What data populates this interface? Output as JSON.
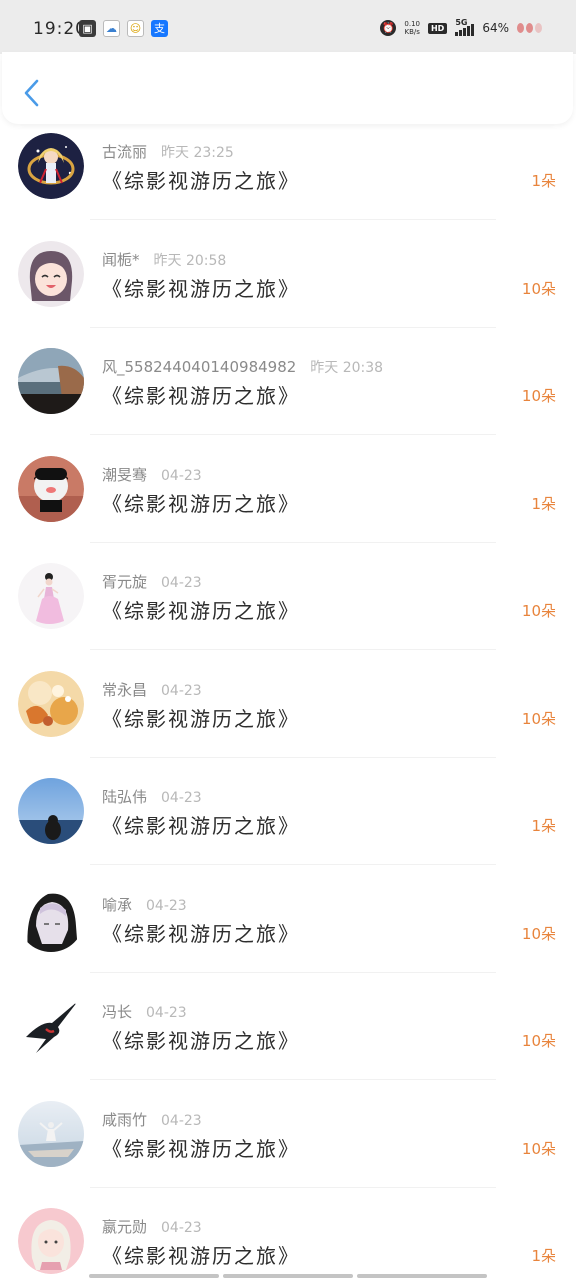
{
  "status_bar": {
    "time": "19:20",
    "net_speed_value": "0.10",
    "net_speed_unit": "KB/s",
    "hd": "HD",
    "network": "5G",
    "battery": "64%"
  },
  "header": {
    "back_icon": "chevron-left-icon"
  },
  "colors": {
    "accent": "#e8843c",
    "back": "#4a9be8"
  },
  "gifts": [
    {
      "user": "古流丽",
      "time": "昨天 23:25",
      "work": "《综影视游历之旅》",
      "count": "1朵"
    },
    {
      "user": "闻栀*",
      "time": "昨天 20:58",
      "work": "《综影视游历之旅》",
      "count": "10朵"
    },
    {
      "user": "风_558244040140984982",
      "time": "昨天 20:38",
      "work": "《综影视游历之旅》",
      "count": "10朵"
    },
    {
      "user": "潮旻骞",
      "time": "04-23",
      "work": "《综影视游历之旅》",
      "count": "1朵"
    },
    {
      "user": "胥元旋",
      "time": "04-23",
      "work": "《综影视游历之旅》",
      "count": "10朵"
    },
    {
      "user": "常永昌",
      "time": "04-23",
      "work": "《综影视游历之旅》",
      "count": "10朵"
    },
    {
      "user": "陆弘伟",
      "time": "04-23",
      "work": "《综影视游历之旅》",
      "count": "1朵"
    },
    {
      "user": "喻承",
      "time": "04-23",
      "work": "《综影视游历之旅》",
      "count": "10朵"
    },
    {
      "user": "冯长",
      "time": "04-23",
      "work": "《综影视游历之旅》",
      "count": "10朵"
    },
    {
      "user": "咸雨竹",
      "time": "04-23",
      "work": "《综影视游历之旅》",
      "count": "10朵"
    },
    {
      "user": "嬴元勋",
      "time": "04-23",
      "work": "《综影视游历之旅》",
      "count": "1朵"
    }
  ]
}
